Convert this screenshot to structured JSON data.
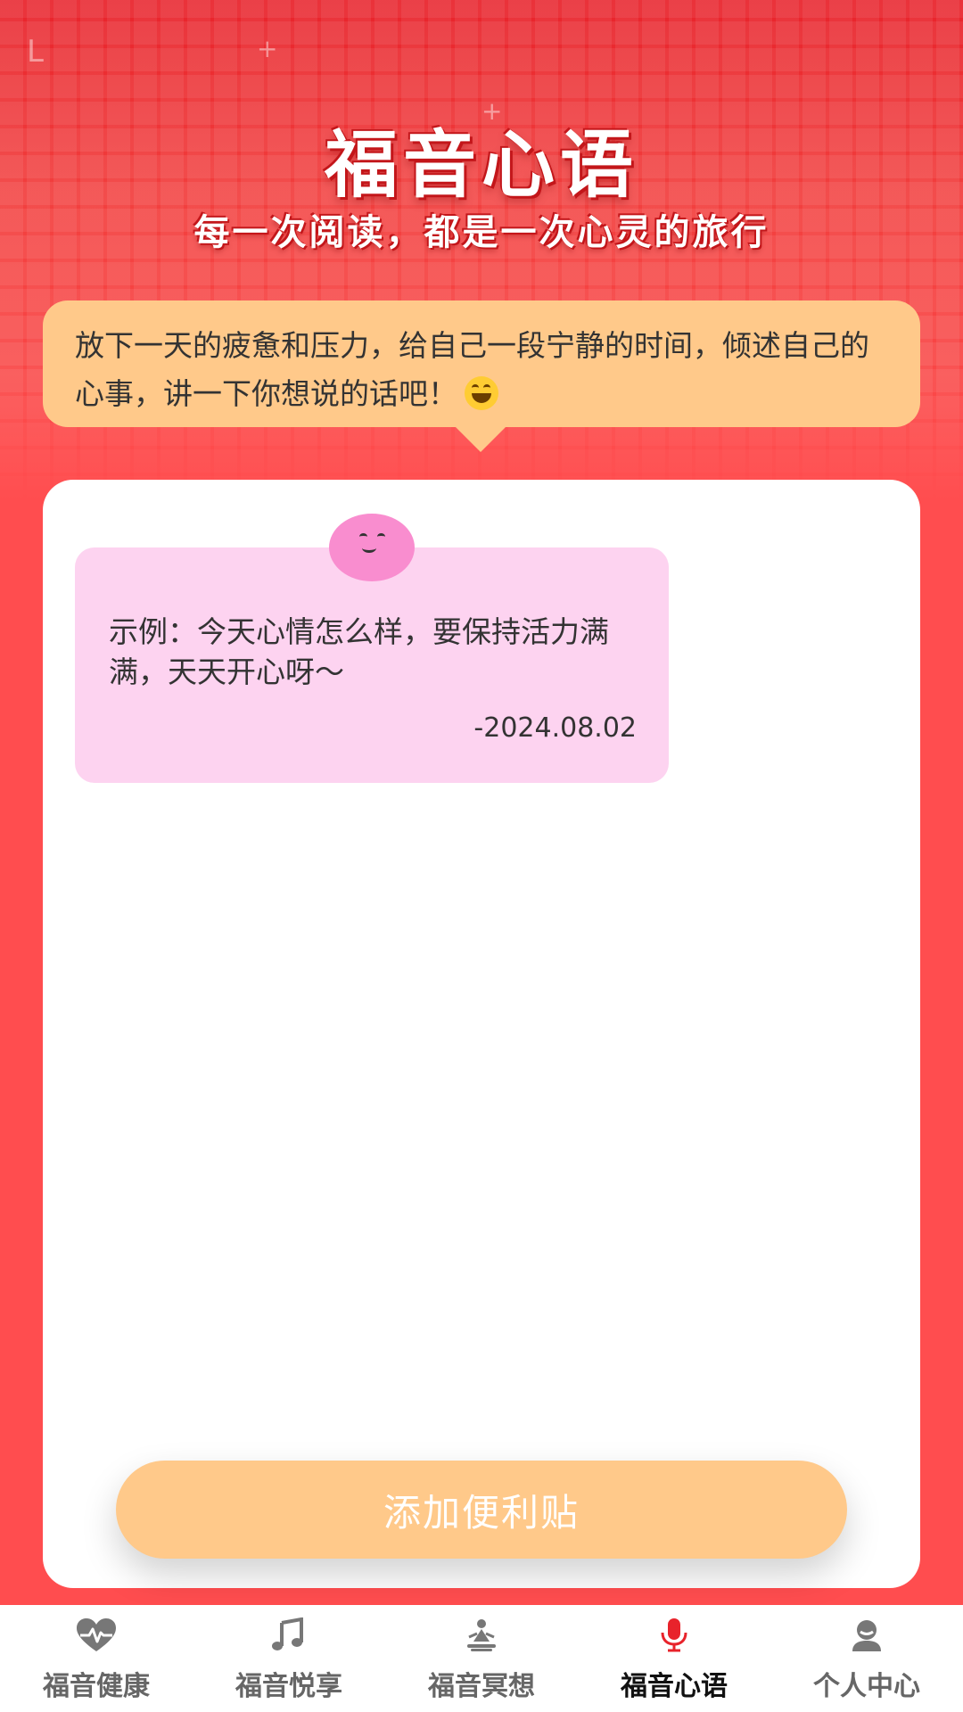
{
  "header": {
    "title": "福音心语",
    "subtitle": "每一次阅读，都是一次心灵的旅行"
  },
  "prompt": {
    "text": "放下一天的疲惫和压力，给自己一段宁静的时间，倾述自己的心事，讲一下你想说的话吧！",
    "emoji_icon": "grinning-face-icon"
  },
  "notes": [
    {
      "text": "示例：今天心情怎么样，要保持活力满满，天天开心呀～",
      "date": "-2024.08.02",
      "icon": "smiley-face-icon"
    }
  ],
  "add_button_label": "添加便利贴",
  "tabbar": {
    "active_index": 3,
    "tabs": [
      {
        "label": "福音健康",
        "icon": "heart-pulse-icon"
      },
      {
        "label": "福音悦享",
        "icon": "music-note-icon"
      },
      {
        "label": "福音冥想",
        "icon": "meditation-icon"
      },
      {
        "label": "福音心语",
        "icon": "microphone-icon"
      },
      {
        "label": "个人中心",
        "icon": "user-icon"
      }
    ]
  },
  "colors": {
    "hero_red": "#e8232b",
    "background_red": "#ff4d4f",
    "bubble_orange": "#ffc98a",
    "note_pink": "#fdd3f0",
    "face_pink": "#f98dcf",
    "tab_active_icon": "#e8232b",
    "tab_inactive_icon": "#777777"
  }
}
